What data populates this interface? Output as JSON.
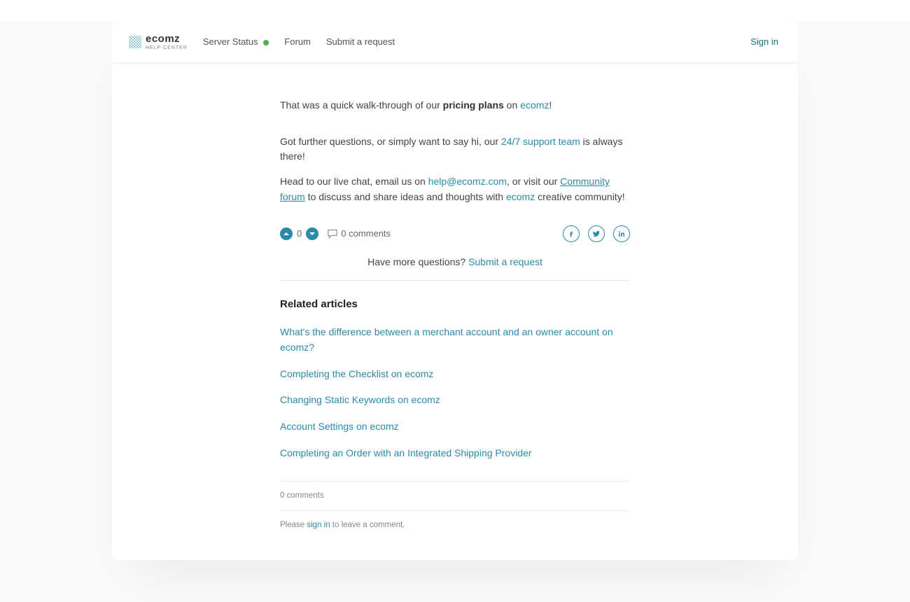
{
  "header": {
    "logo_main": "ecomz",
    "logo_sub": "HELP CENTER",
    "server_status_label": "Server Status",
    "forum_label": "Forum",
    "submit_label": "Submit a request",
    "signin_label": "Sign in"
  },
  "article": {
    "p1_a": "That was a quick walk-through of our ",
    "p1_b_bold": "pricing plans",
    "p1_c": " on ",
    "p1_link": "ecomz",
    "p1_d": "!",
    "p2_a": "Got further questions, or simply want to say hi, our ",
    "p2_link": "24/7 support team",
    "p2_b": " is always there!",
    "p3_a": "Head to our live chat, email us on ",
    "p3_email": "help@ecomz.com",
    "p3_b": ", or visit our ",
    "p3_forum": "Community forum",
    "p3_c": " to discuss and share ideas and thoughts with ",
    "p3_ecomz": "ecomz",
    "p3_d": " creative community!"
  },
  "votes": {
    "count": "0",
    "comments_label": "0 comments"
  },
  "more_questions": {
    "text": "Have more questions? ",
    "link": "Submit a request"
  },
  "related": {
    "title": "Related articles",
    "items": [
      "What's the difference between a merchant account and an owner account on ecomz?",
      "Completing the Checklist on ecomz",
      "Changing Static Keywords on ecomz",
      "Account Settings on ecomz",
      "Completing an Order with an Integrated Shipping Provider"
    ]
  },
  "comments_section": {
    "count_label": "0 comments",
    "signin_a": "Please ",
    "signin_link": "sign in",
    "signin_b": " to leave a comment."
  }
}
